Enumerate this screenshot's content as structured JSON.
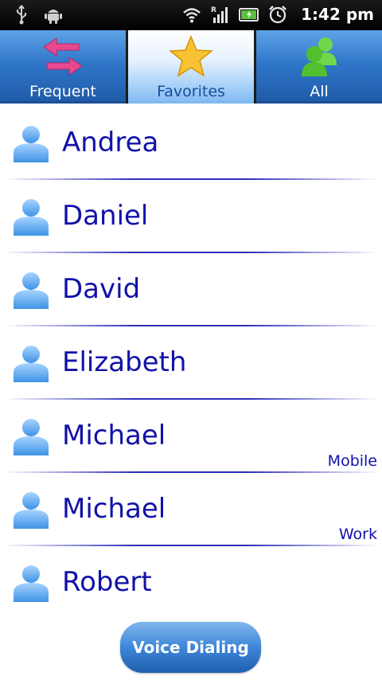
{
  "status_bar": {
    "time": "1:42 pm",
    "left_icons": [
      "usb-icon",
      "android-debug-icon"
    ],
    "right_icons": [
      "wifi-icon",
      "roaming-signal-icon",
      "battery-icon",
      "alarm-icon"
    ]
  },
  "tabs": [
    {
      "label": "Frequent",
      "icon": "swap-arrows-icon",
      "active": false
    },
    {
      "label": "Favorites",
      "icon": "star-icon",
      "active": true
    },
    {
      "label": "All",
      "icon": "people-icon",
      "active": false
    }
  ],
  "contacts": [
    {
      "name": "Andrea",
      "sub": ""
    },
    {
      "name": "Daniel",
      "sub": ""
    },
    {
      "name": "David",
      "sub": ""
    },
    {
      "name": "Elizabeth",
      "sub": ""
    },
    {
      "name": "Michael",
      "sub": "Mobile"
    },
    {
      "name": "Michael",
      "sub": "Work"
    },
    {
      "name": "Robert",
      "sub": ""
    }
  ],
  "voice_button": {
    "label": "Voice Dialing"
  },
  "colors": {
    "tab_blue": "#2f76c9",
    "contact_text": "#1111aa",
    "accent_pink": "#e0408a",
    "star_gold": "#f5b800",
    "people_green": "#5ccd3b"
  }
}
